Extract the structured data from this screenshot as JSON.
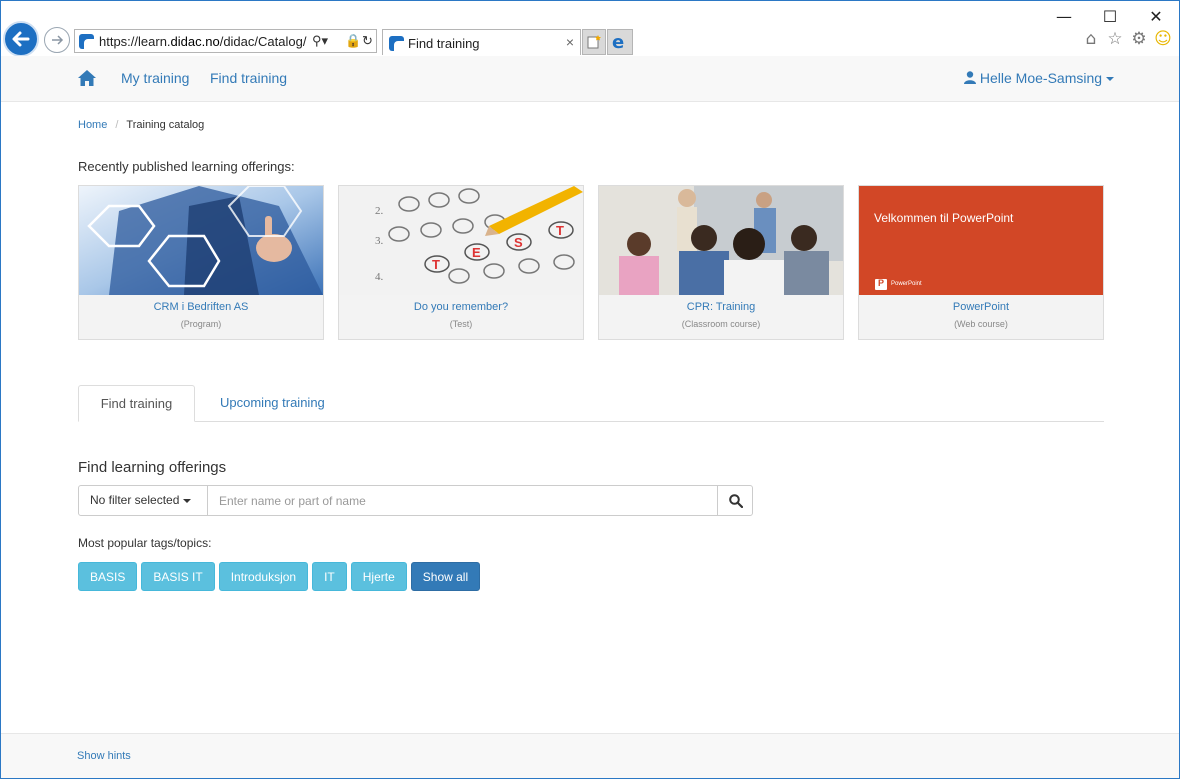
{
  "browser": {
    "url_prefix": "https://learn.",
    "url_domain": "didac.no",
    "url_path": "/didac/Catalog/",
    "tab_title": "Find training",
    "tab_close": "×",
    "window_controls": [
      "—",
      "☐",
      "✕"
    ],
    "toolbar_icons": [
      "⌂",
      "☆",
      "⚙",
      "☺"
    ]
  },
  "nav": {
    "links": [
      "My training",
      "Find training"
    ],
    "user_name": "Helle Moe-Samsing",
    "accent_color": "#337ab7"
  },
  "breadcrumb": {
    "home": "Home",
    "separator": "/",
    "current": "Training catalog"
  },
  "recent": {
    "heading": "Recently published learning offerings:",
    "cards": [
      {
        "title": "CRM i Bedriften AS",
        "type": "(Program)"
      },
      {
        "title": "Do you remember?",
        "type": "(Test)"
      },
      {
        "title": "CPR: Training",
        "type": "(Classroom course)"
      },
      {
        "title": "PowerPoint",
        "type": "(Web course)",
        "slide_text": "Velkommen til PowerPoint",
        "app_label": "PowerPoint"
      }
    ]
  },
  "tabs": {
    "active": "Find training",
    "inactive": "Upcoming training"
  },
  "find": {
    "heading": "Find learning offerings",
    "filter_label": "No filter selected",
    "search_placeholder": "Enter name or part of name"
  },
  "tags": {
    "heading": "Most popular tags/topics:",
    "items": [
      "BASIS",
      "BASIS IT",
      "Introduksjon",
      "IT",
      "Hjerte"
    ],
    "show_all": "Show all"
  },
  "footer": {
    "hints": "Show hints"
  }
}
